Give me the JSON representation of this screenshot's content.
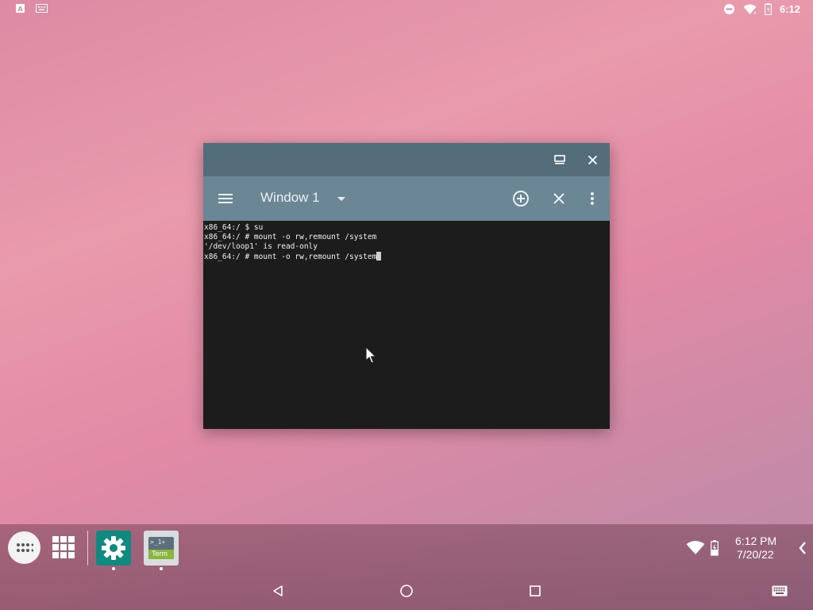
{
  "status_bar": {
    "time": "6:12",
    "icons": [
      "notification-a-icon",
      "keyboard-notification-icon",
      "do-not-disturb-icon",
      "wifi-icon",
      "battery-icon"
    ]
  },
  "window": {
    "title": "Window 1",
    "titlebar_buttons": [
      "maximize-icon",
      "close-icon"
    ],
    "toolbar_icons": [
      "menu-icon",
      "dropdown-arrow-icon",
      "add-window-icon",
      "close-window-icon",
      "more-options-icon"
    ]
  },
  "terminal": {
    "lines": [
      "x86_64:/ $ su",
      "x86_64:/ # mount -o rw,remount /system",
      "'/dev/loop1' is read-only",
      "x86_64:/ # mount -o rw,remount /system"
    ]
  },
  "taskbar": {
    "apps": [
      {
        "name": "Settings",
        "icon": "settings-gear-icon",
        "color": "#0e8a7e"
      },
      {
        "name": "Terminal",
        "icon": "terminal-app-icon",
        "label_top": ">_1+",
        "label_bottom": "Term"
      }
    ],
    "clock_time": "6:12 PM",
    "clock_date": "7/20/22",
    "tray_icons": [
      "wifi-icon",
      "battery-charging-icon"
    ],
    "expand_icon": "chevron-left-icon"
  },
  "nav_bar": {
    "buttons": [
      "back-icon",
      "home-icon",
      "recents-icon",
      "keyboard-icon"
    ]
  },
  "colors": {
    "titlebar": "#536d7b",
    "toolbar": "#6b8795",
    "terminal_bg": "#1c1c1c",
    "terminal_fg": "#f2f2f2"
  }
}
